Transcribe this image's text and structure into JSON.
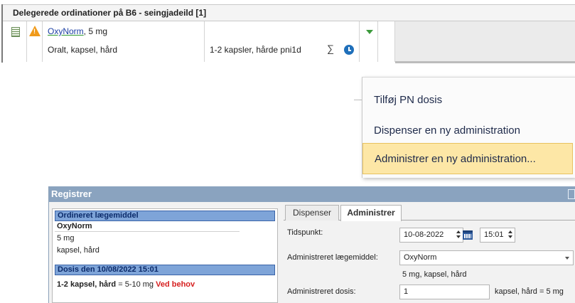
{
  "ordination_panel": {
    "header": "Delegerede ordinationer på B6 - seingjadeild [1]",
    "row": {
      "drug_link": "OxyNorm",
      "drug_strength": ", 5 mg",
      "drug_form": "Oralt, kapsel, hård",
      "dose_text": "1-2 kapsler, hårde  pni1d",
      "sigma_symbol": "∑"
    }
  },
  "context_menu": {
    "items": [
      {
        "label": "Tilføj PN dosis"
      },
      {
        "label": "Dispenser en ny administration"
      },
      {
        "label": "Administrer en ny administration..."
      }
    ],
    "highlight_color": "#fde7a6"
  },
  "register_dialog": {
    "title": "Registrer",
    "left_pane": {
      "section1_title": "Ordineret lægemiddel",
      "drug_name": "OxyNorm",
      "strength": "5 mg",
      "form": "kapsel, hård",
      "section2_title": "Dosis den 10/08/2022 15:01",
      "dose_bold": "1-2 kapsel, hård",
      "dose_rest": " = 5-10 mg ",
      "dose_flag": "Ved behov"
    },
    "tabs": [
      {
        "label": "Dispenser",
        "active": false
      },
      {
        "label": "Administrer",
        "active": true
      }
    ],
    "form": {
      "time_label": "Tidspunkt:",
      "date_value": "10-08-2022",
      "time_value": "15:01",
      "drug_label": "Administreret lægemiddel:",
      "drug_value": "OxyNorm",
      "drug_info": "5 mg, kapsel, hård",
      "dose_label": "Administreret dosis:",
      "dose_value": "1",
      "dose_unit": "kapsel, hård = 5 mg"
    }
  },
  "colors": {
    "title_bar": "#8aa3bf",
    "section_header": "#7ea4d8",
    "warning": "#f09a1a",
    "clock": "#1f6fba",
    "red_flag": "#d62020"
  }
}
